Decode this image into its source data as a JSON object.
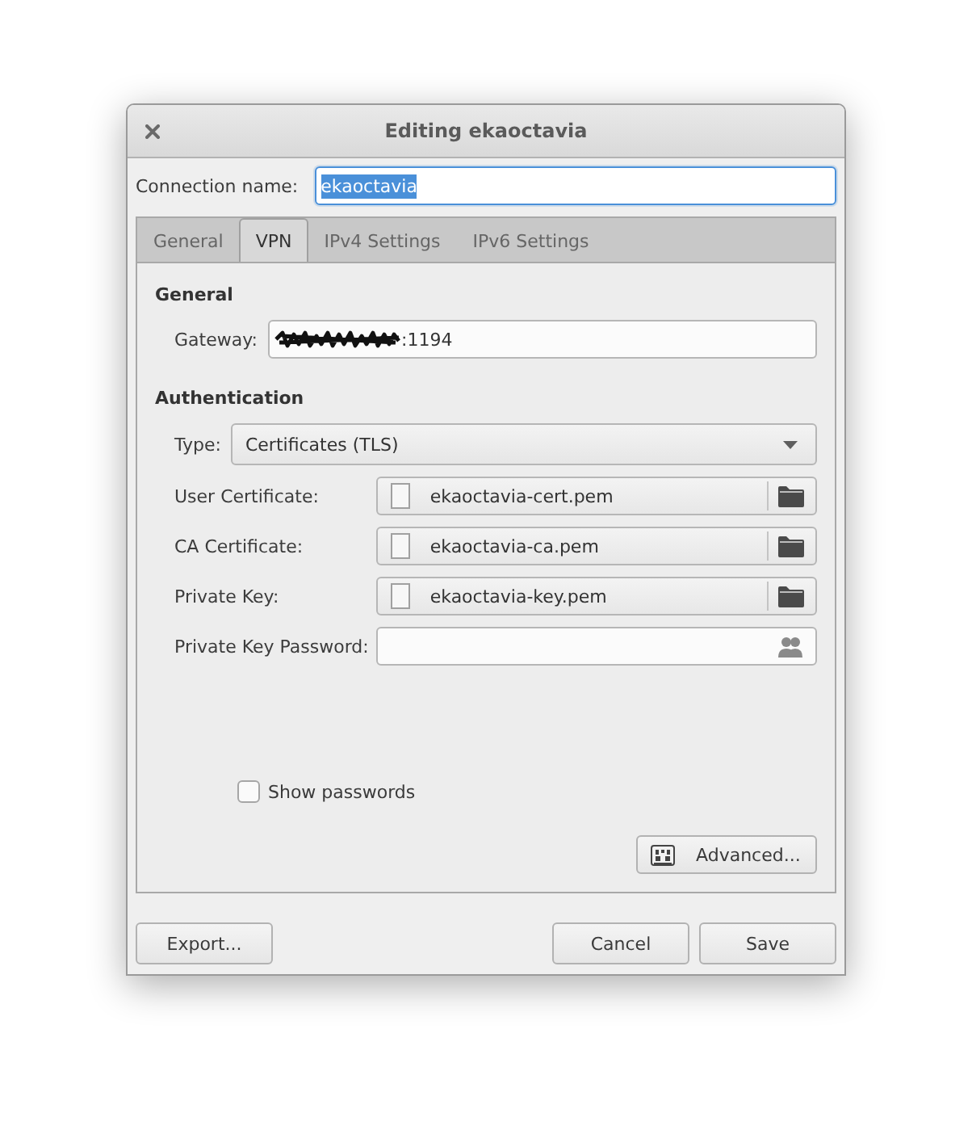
{
  "window": {
    "title": "Editing ekaoctavia"
  },
  "connection_name": {
    "label": "Connection name:",
    "value": "ekaoctavia",
    "focused": true,
    "text_selected": true
  },
  "tabs": [
    {
      "label": "General",
      "selected": false
    },
    {
      "label": "VPN",
      "selected": true
    },
    {
      "label": "IPv4 Settings",
      "selected": false
    },
    {
      "label": "IPv6 Settings",
      "selected": false
    }
  ],
  "vpn": {
    "general": {
      "heading": "General",
      "gateway": {
        "label": "Gateway:",
        "value": ":1194",
        "redacted": true
      }
    },
    "authentication": {
      "heading": "Authentication",
      "type": {
        "label": "Type:",
        "value": "Certificates (TLS)"
      },
      "rows": [
        {
          "kind": "file",
          "label": "User Certificate:",
          "file": "ekaoctavia-cert.pem"
        },
        {
          "kind": "file",
          "label": "CA Certificate:",
          "file": "ekaoctavia-ca.pem"
        },
        {
          "kind": "file",
          "label": "Private Key:",
          "file": "ekaoctavia-key.pem"
        },
        {
          "kind": "password",
          "label": "Private Key Password:"
        }
      ]
    },
    "show_passwords": {
      "label": "Show passwords",
      "checked": false
    },
    "advanced_button": {
      "label": "Advanced..."
    }
  },
  "footer": {
    "start_buttons": [
      {
        "label": "Export..."
      }
    ],
    "end_buttons": [
      {
        "label": "Cancel"
      },
      {
        "label": "Save"
      }
    ]
  }
}
